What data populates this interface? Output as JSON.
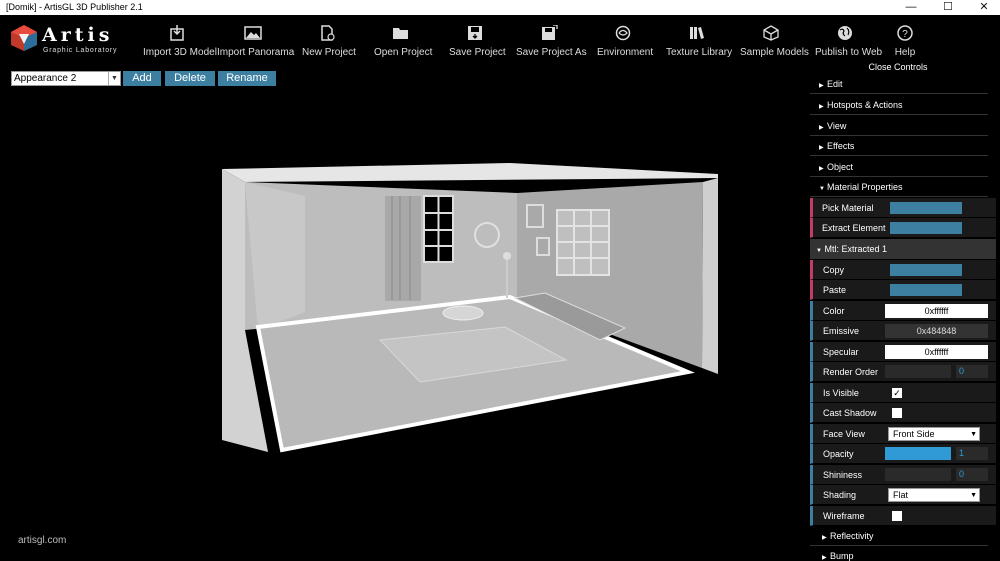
{
  "window": {
    "title": "[Domik] - ArtisGL 3D Publisher 2.1"
  },
  "logo": {
    "wordmark": "Artis",
    "subtitle": "Graphic Laboratory"
  },
  "toolbar": {
    "items": [
      {
        "label": "Import 3D Model",
        "icon": "import-model-icon"
      },
      {
        "label": "Import Panorama",
        "icon": "panorama-icon"
      },
      {
        "label": "New Project",
        "icon": "new-project-icon"
      },
      {
        "label": "Open Project",
        "icon": "folder-open-icon"
      },
      {
        "label": "Save Project",
        "icon": "save-icon"
      },
      {
        "label": "Save Project As",
        "icon": "save-as-icon"
      },
      {
        "label": "Environment",
        "icon": "environment-icon"
      },
      {
        "label": "Texture Library",
        "icon": "texture-library-icon"
      },
      {
        "label": "Sample Models",
        "icon": "sample-models-icon"
      },
      {
        "label": "Publish to Web",
        "icon": "globe-icon"
      },
      {
        "label": "Help",
        "icon": "help-icon"
      }
    ]
  },
  "appearance": {
    "selected": "Appearance 2",
    "add_label": "Add",
    "delete_label": "Delete",
    "rename_label": "Rename"
  },
  "watermark": "artisgl.com",
  "panel": {
    "close_label": "Close Controls",
    "sections": [
      "Edit",
      "Hotspots & Actions",
      "View",
      "Effects",
      "Object",
      "Material Properties"
    ],
    "pick_material": "Pick Material",
    "extract_element": "Extract Element",
    "material_name": "Mtl: Extracted 1",
    "copy": "Copy",
    "paste": "Paste",
    "color_label": "Color",
    "color_value": "0xffffff",
    "emissive_label": "Emissive",
    "emissive_value": "0x484848",
    "specular_label": "Specular",
    "specular_value": "0xffffff",
    "render_order_label": "Render Order",
    "render_order_value": "0",
    "is_visible_label": "Is Visible",
    "is_visible": true,
    "cast_shadow_label": "Cast Shadow",
    "cast_shadow": false,
    "face_view_label": "Face View",
    "face_view_value": "Front Side",
    "opacity_label": "Opacity",
    "opacity_value": "1",
    "shininess_label": "Shininess",
    "shininess_value": "0",
    "shading_label": "Shading",
    "shading_value": "Flat",
    "wireframe_label": "Wireframe",
    "wireframe": false,
    "bottom_sections": [
      "Reflectivity",
      "Bump"
    ]
  },
  "colors": {
    "accent": "#3d7fa1",
    "highlight_pink": "#c43b6a",
    "slider_blue": "#2f9ad6"
  }
}
